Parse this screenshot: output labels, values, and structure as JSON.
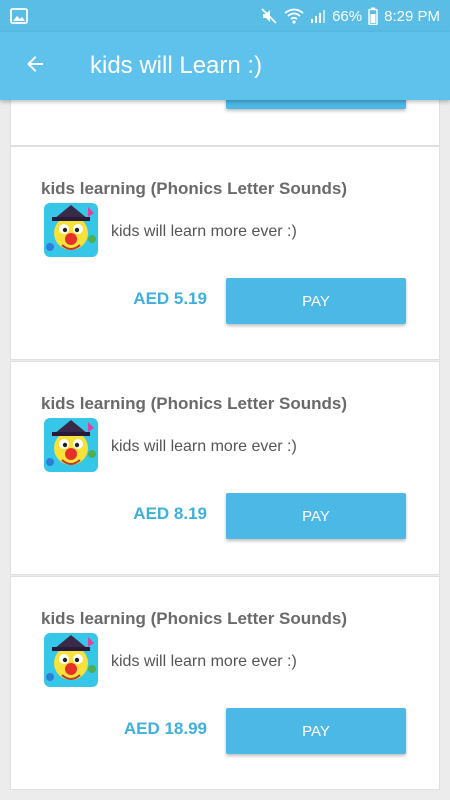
{
  "status_bar": {
    "battery_percent": "66%",
    "time": "8:29 PM"
  },
  "app_bar": {
    "title": "kids will Learn :)"
  },
  "items": [
    {
      "title": "kids learning (Phonics Letter Sounds)",
      "description": "kids will learn more ever :)",
      "price": "AED 5.19",
      "button_label": "PAY"
    },
    {
      "title": "kids learning (Phonics Letter Sounds)",
      "description": "kids will learn more ever :)",
      "price": "AED 8.19",
      "button_label": "PAY"
    },
    {
      "title": "kids learning (Phonics Letter Sounds)",
      "description": "kids will learn more ever :)",
      "price": "AED 18.99",
      "button_label": "PAY"
    }
  ],
  "colors": {
    "primary": "#5ec2ec",
    "status_bar": "#59bde6",
    "price_text": "#3fb0dc",
    "button": "#4cb8e6"
  }
}
